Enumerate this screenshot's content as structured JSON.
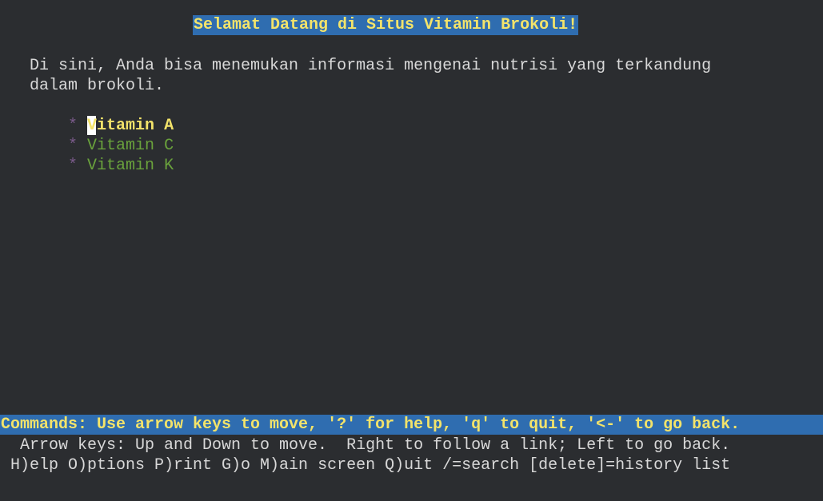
{
  "page": {
    "title": "Selamat Datang di Situs Vitamin Brokoli!",
    "intro_line1": "Di sini, Anda bisa menemukan informasi mengenai nutrisi yang terkandung",
    "intro_line2": "dalam brokoli.",
    "bullet": "*",
    "links": [
      {
        "label": "Vitamin A",
        "selected": true
      },
      {
        "label": "Vitamin C",
        "selected": false
      },
      {
        "label": "Vitamin K",
        "selected": false
      }
    ]
  },
  "statusbar": {
    "commands": "Commands: Use arrow keys to move, '?' for help, 'q' to quit, '<-' to go back.",
    "help_line1": "Arrow keys: Up and Down to move.  Right to follow a link; Left to go back.",
    "help_line2": "H)elp O)ptions P)rint G)o M)ain screen Q)uit /=search [delete]=history list"
  },
  "colors": {
    "background": "#2b2d30",
    "highlight_bar": "#2f6db0",
    "highlight_text": "#f3e36a",
    "link": "#6aa23c"
  }
}
